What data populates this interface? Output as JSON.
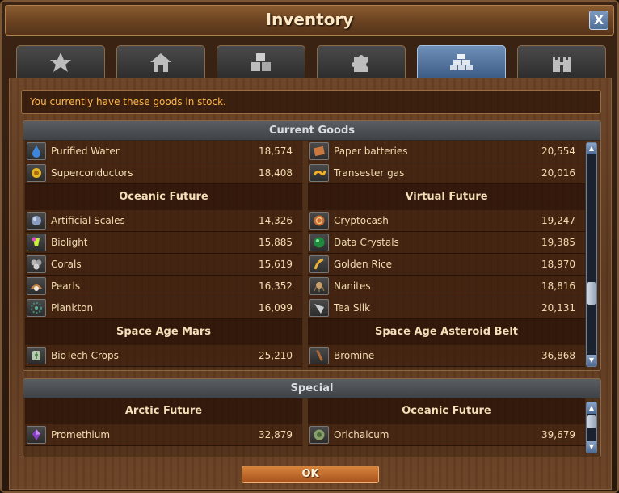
{
  "window": {
    "title": "Inventory",
    "close_label": "X"
  },
  "tabs": [
    {
      "name": "star-icon",
      "active": false
    },
    {
      "name": "house-icon",
      "active": false
    },
    {
      "name": "crates-icon",
      "active": false
    },
    {
      "name": "puzzle-icon",
      "active": false
    },
    {
      "name": "goods-bricks-icon",
      "active": true
    },
    {
      "name": "castle-icon",
      "active": false
    }
  ],
  "info": {
    "message": "You currently have these goods in stock."
  },
  "current_goods": {
    "header": "Current Goods",
    "left": {
      "top_rows": [
        {
          "icon": "water-drop-icon",
          "name": "Purified Water",
          "qty": "18,574"
        },
        {
          "icon": "superconductor-icon",
          "name": "Superconductors",
          "qty": "18,408"
        }
      ],
      "section1": {
        "title": "Oceanic Future",
        "rows": [
          {
            "icon": "scales-icon",
            "name": "Artificial Scales",
            "qty": "14,326"
          },
          {
            "icon": "biolight-icon",
            "name": "Biolight",
            "qty": "15,885"
          },
          {
            "icon": "corals-icon",
            "name": "Corals",
            "qty": "15,619"
          },
          {
            "icon": "pearls-icon",
            "name": "Pearls",
            "qty": "16,352"
          },
          {
            "icon": "plankton-icon",
            "name": "Plankton",
            "qty": "16,099"
          }
        ]
      },
      "section2": {
        "title": "Space Age Mars",
        "rows": [
          {
            "icon": "biotech-crops-icon",
            "name": "BioTech Crops",
            "qty": "25,210"
          }
        ]
      }
    },
    "right": {
      "top_rows": [
        {
          "icon": "paper-batteries-icon",
          "name": "Paper batteries",
          "qty": "20,554"
        },
        {
          "icon": "transester-gas-icon",
          "name": "Transester gas",
          "qty": "20,016"
        }
      ],
      "section1": {
        "title": "Virtual Future",
        "rows": [
          {
            "icon": "cryptocash-icon",
            "name": "Cryptocash",
            "qty": "19,247"
          },
          {
            "icon": "data-crystals-icon",
            "name": "Data Crystals",
            "qty": "19,385"
          },
          {
            "icon": "golden-rice-icon",
            "name": "Golden Rice",
            "qty": "18,970"
          },
          {
            "icon": "nanites-icon",
            "name": "Nanites",
            "qty": "18,816"
          },
          {
            "icon": "tea-silk-icon",
            "name": "Tea Silk",
            "qty": "20,131"
          }
        ]
      },
      "section2": {
        "title": "Space Age Asteroid Belt",
        "rows": [
          {
            "icon": "bromine-icon",
            "name": "Bromine",
            "qty": "36,868"
          }
        ]
      }
    }
  },
  "special": {
    "header": "Special",
    "left": {
      "title": "Arctic Future",
      "rows": [
        {
          "icon": "promethium-icon",
          "name": "Promethium",
          "qty": "32,879"
        }
      ]
    },
    "right": {
      "title": "Oceanic Future",
      "rows": [
        {
          "icon": "orichalcum-icon",
          "name": "Orichalcum",
          "qty": "39,679"
        }
      ]
    }
  },
  "footer": {
    "ok_label": "OK"
  },
  "colors": {
    "accent_orange": "#ffb54a",
    "tab_active": "#5b7ca6",
    "ok_button": "#c06a2c"
  }
}
